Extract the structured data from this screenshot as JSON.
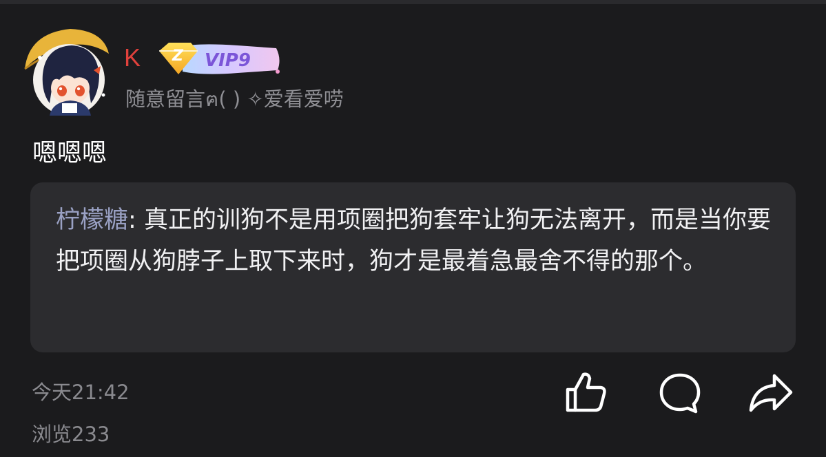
{
  "post": {
    "author": {
      "name": "K",
      "vip_level": "VIP9",
      "vip_emblem": "Z",
      "signature": "随意留言ฅ( ) ✧爱看爱唠"
    },
    "content": "嗯嗯嗯",
    "quote": {
      "author": "柠檬糖",
      "separator": ": ",
      "text": "真正的训狗不是用项圈把狗套牢让狗无法离开，而是当你要把项圈从狗脖子上取下来时，狗才是最着急最舍不得的那个。"
    },
    "timestamp": "今天21:42",
    "views": "浏览233"
  },
  "actions": {
    "like_icon": "thumbs-up-icon",
    "comment_icon": "comment-bubble-icon",
    "share_icon": "share-arrow-icon"
  },
  "colors": {
    "background": "#1b1b1d",
    "username": "#e0413c",
    "quote_author": "#9aa1c4",
    "quote_background": "#2c2c2f",
    "meta_text": "#8a8a8f"
  }
}
